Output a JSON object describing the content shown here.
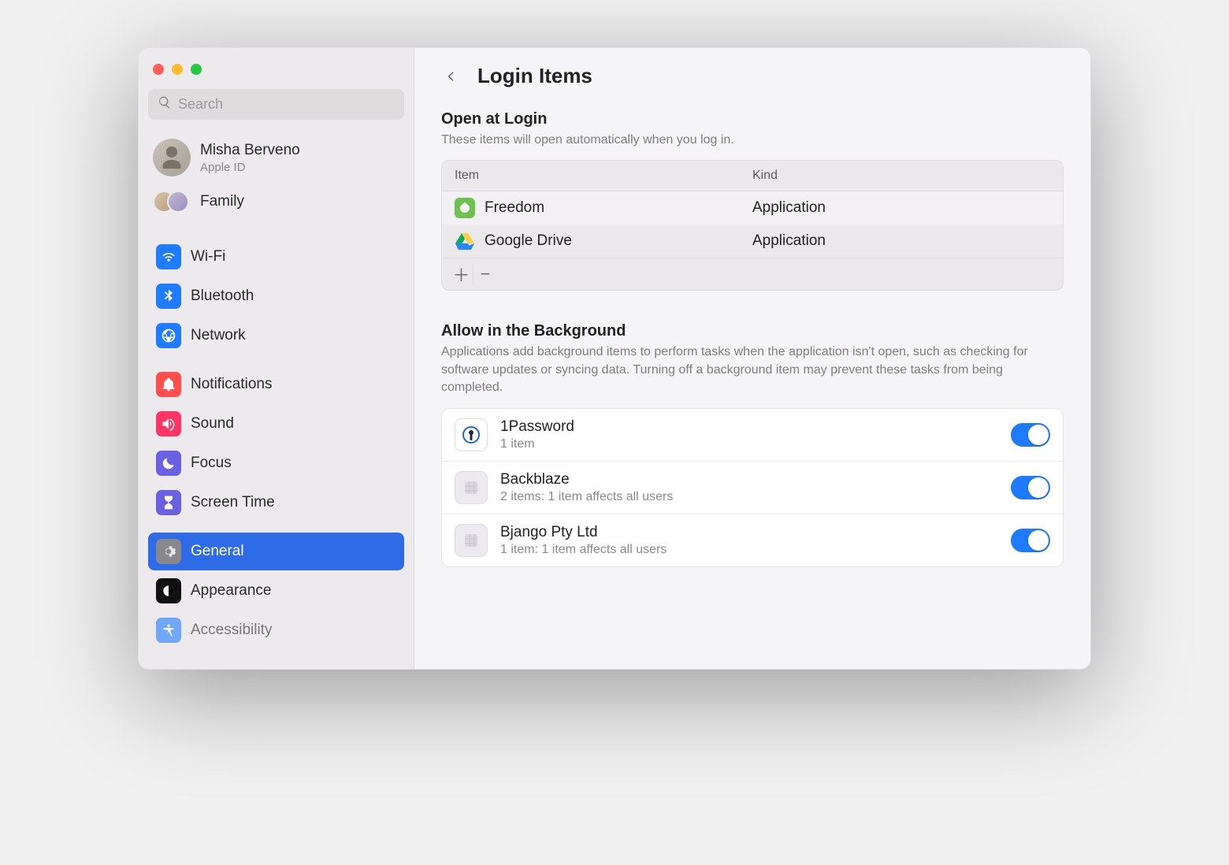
{
  "search": {
    "placeholder": "Search"
  },
  "account": {
    "name": "Misha Berveno",
    "subtitle": "Apple ID"
  },
  "family": {
    "label": "Family"
  },
  "sidebar": {
    "group1": [
      {
        "id": "wifi",
        "label": "Wi-Fi"
      },
      {
        "id": "bluetooth",
        "label": "Bluetooth"
      },
      {
        "id": "network",
        "label": "Network"
      }
    ],
    "group2": [
      {
        "id": "notifications",
        "label": "Notifications"
      },
      {
        "id": "sound",
        "label": "Sound"
      },
      {
        "id": "focus",
        "label": "Focus"
      },
      {
        "id": "screentime",
        "label": "Screen Time"
      }
    ],
    "group3": [
      {
        "id": "general",
        "label": "General",
        "selected": true
      },
      {
        "id": "appearance",
        "label": "Appearance"
      },
      {
        "id": "accessibility",
        "label": "Accessibility"
      }
    ]
  },
  "page": {
    "title": "Login Items",
    "open_at_login": {
      "heading": "Open at Login",
      "description": "These items will open automatically when you log in.",
      "columns": {
        "item": "Item",
        "kind": "Kind"
      },
      "rows": [
        {
          "name": "Freedom",
          "kind": "Application",
          "icon": "freedom"
        },
        {
          "name": "Google Drive",
          "kind": "Application",
          "icon": "gdrive"
        }
      ]
    },
    "background": {
      "heading": "Allow in the Background",
      "description": "Applications add background items to perform tasks when the application isn't open, such as checking for software updates or syncing data. Turning off a background item may prevent these tasks from being completed.",
      "rows": [
        {
          "name": "1Password",
          "subtitle": "1 item",
          "icon": "1password",
          "enabled": true
        },
        {
          "name": "Backblaze",
          "subtitle": "2 items: 1 item affects all users",
          "icon": "placeholder",
          "enabled": true
        },
        {
          "name": "Bjango Pty Ltd",
          "subtitle": "1 item: 1 item affects all users",
          "icon": "placeholder",
          "enabled": true
        }
      ]
    }
  }
}
